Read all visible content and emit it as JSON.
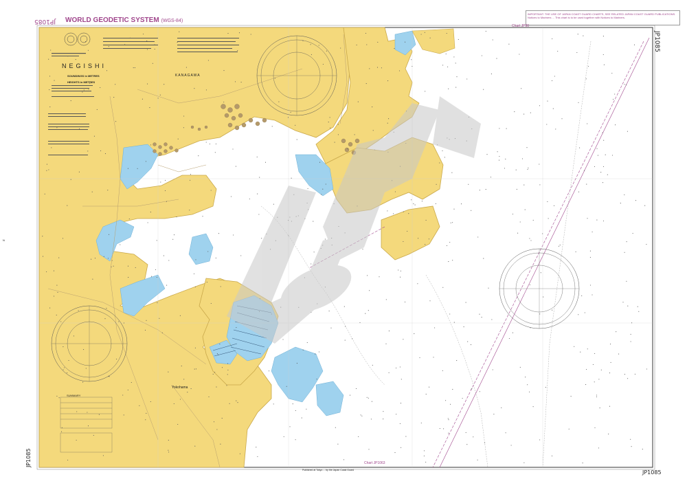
{
  "header": {
    "chart_number": "JP1085",
    "system_title": "WORLD GEODETIC SYSTEM",
    "system_subtitle": "(WGS-84)",
    "notice_text": "IMPORTANT: THE USE OF JAPAN COAST GUARD CHARTS, SEE RELATED JAPAN COAST GUARD PUBLICATIONS. Notices to Mariners ... This chart is to be used together with Notices to Mariners."
  },
  "chart_ids": {
    "right_top": "JP1085",
    "bottom_right": "JP1085",
    "left_bottom": "JP1085"
  },
  "adjacent_charts": {
    "top": "Chart JP90",
    "bottom": "Chart JP1063"
  },
  "title_block": {
    "name": "NEGISHI",
    "soundings": "SOUNDINGS in METRES",
    "heights": "HEIGHTS in METRES"
  },
  "places": {
    "kanagawa": "KANAGAWA",
    "yokohama": "Yokohama"
  },
  "summary": {
    "title": "SUMMARY"
  },
  "footer": {
    "publication": "Published at Tokyo ... by the Japan Coast Guard"
  },
  "letters": {
    "n": "N"
  },
  "colors": {
    "land": "#f4d97c",
    "land_edge": "#c9a84a",
    "shallow_water": "#9fd2ee",
    "deep_water": "#ffffff",
    "accent": "#a0468c",
    "watermark": "#d5d5d5"
  },
  "icons": [
    "compass-rose-icon",
    "seal-icon",
    "storage-tank-icon"
  ]
}
